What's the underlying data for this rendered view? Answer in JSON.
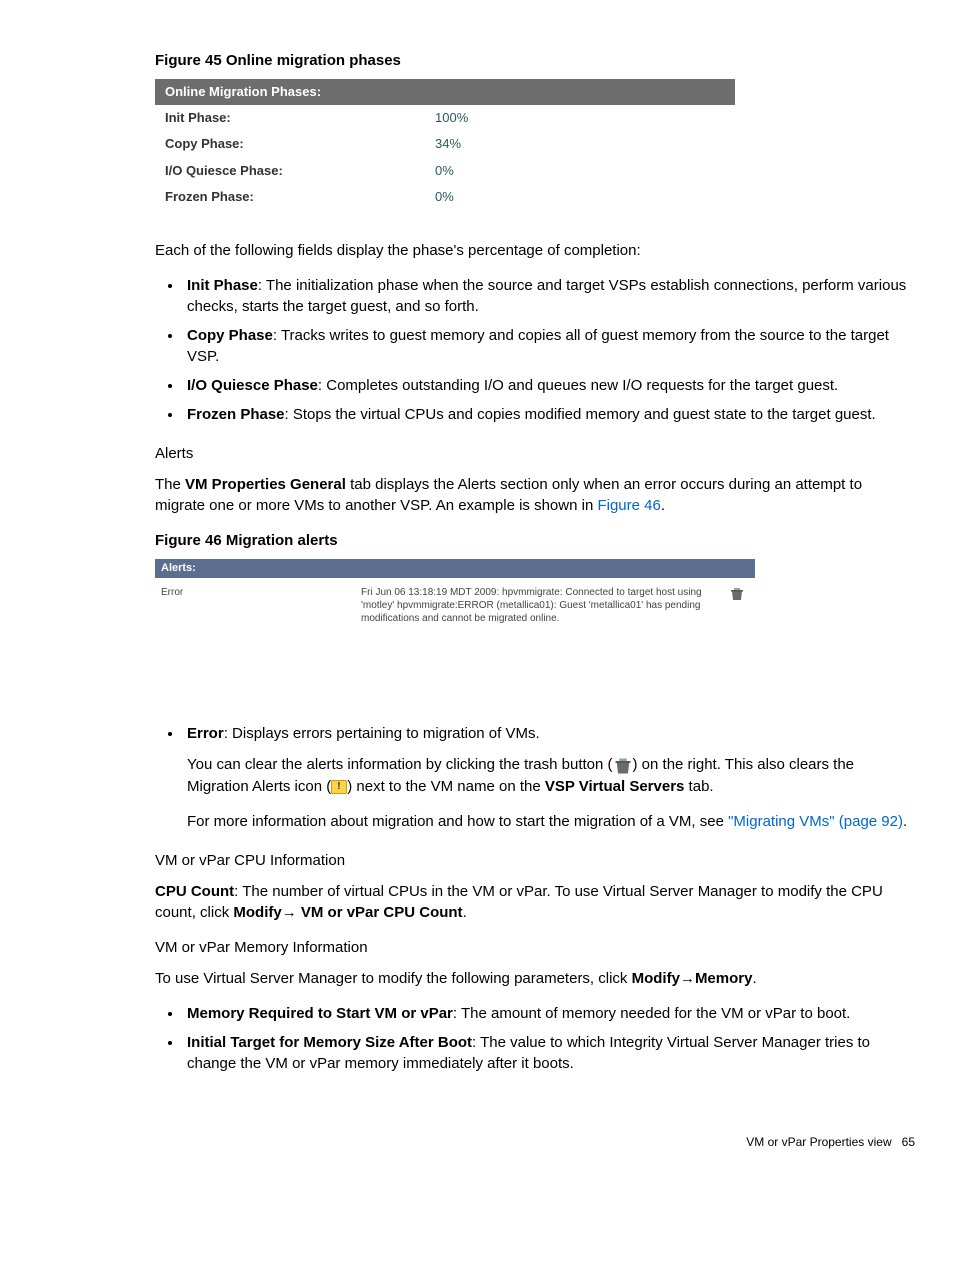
{
  "figure45": {
    "caption": "Figure 45 Online migration phases",
    "header": "Online Migration Phases:",
    "rows": [
      {
        "label": "Init Phase:",
        "value": "100%"
      },
      {
        "label": "Copy Phase:",
        "value": "34%"
      },
      {
        "label": "I/O Quiesce Phase:",
        "value": "0%"
      },
      {
        "label": "Frozen Phase:",
        "value": "0%"
      }
    ]
  },
  "intro_line": "Each of the following fields display the phase's percentage of completion:",
  "phase_items": [
    {
      "title": "Init Phase",
      "desc": ": The initialization phase when the source and target VSPs establish connections, perform various checks, starts the target guest, and so forth."
    },
    {
      "title": "Copy Phase",
      "desc": ": Tracks writes to guest memory and copies all of guest memory from the source to the target VSP."
    },
    {
      "title": "I/O Quiesce Phase",
      "desc": ": Completes outstanding I/O and queues new I/O requests for the target guest."
    },
    {
      "title": "Frozen Phase",
      "desc": ": Stops the virtual CPUs and copies modified memory and guest state to the target guest."
    }
  ],
  "alerts": {
    "heading": "Alerts",
    "para_pre": "The ",
    "para_bold": "VM Properties General",
    "para_mid": " tab displays the Alerts section only when an error occurs during an attempt to migrate one or more VMs to another VSP. An example is shown in ",
    "para_link": "Figure 46",
    "para_end": "."
  },
  "figure46": {
    "caption": "Figure 46 Migration alerts",
    "header": "Alerts:",
    "severity": "Error",
    "message": "Fri Jun 06 13:18:19 MDT 2009: hpvmmigrate: Connected to target host using 'motley' hpvmmigrate:ERROR (metallica01): Guest 'metallica01' has pending modifications and cannot be migrated online."
  },
  "error_item": {
    "title": "Error",
    "desc": ": Displays errors pertaining to migration of VMs.",
    "p2a": "You can clear the alerts information by clicking the trash button (",
    "p2b": ") on the right. This also clears the Migration Alerts icon (",
    "p2c": ") next to the VM name on the ",
    "p2bold": "VSP Virtual Servers",
    "p2d": " tab.",
    "p3a": "For more information about migration and how to start the migration of a VM, see ",
    "p3link": "\"Migrating VMs\" (page 92)",
    "p3b": "."
  },
  "cpu": {
    "heading": "VM or vPar CPU Information",
    "bold": "CPU Count",
    "text1": ": The number of virtual CPUs in the VM or vPar. To use Virtual Server Manager to modify the CPU count, click ",
    "bold2": "Modify",
    "arrow": "→ ",
    "bold3": "VM or vPar CPU Count",
    "text2": "."
  },
  "memory": {
    "heading": "VM or vPar Memory Information",
    "intro_a": "To use Virtual Server Manager to modify the following parameters, click ",
    "intro_bold1": "Modify",
    "arrow": "→",
    "intro_bold2": "Memory",
    "intro_b": ".",
    "items": [
      {
        "title": "Memory Required to Start VM or vPar",
        "desc": ": The amount of memory needed for the VM or vPar to boot."
      },
      {
        "title": "Initial Target for Memory Size After Boot",
        "desc": ": The value to which Integrity Virtual Server Manager tries to change the VM or vPar memory immediately after it boots."
      }
    ]
  },
  "footer": {
    "text": "VM or vPar Properties view",
    "page": "65"
  }
}
